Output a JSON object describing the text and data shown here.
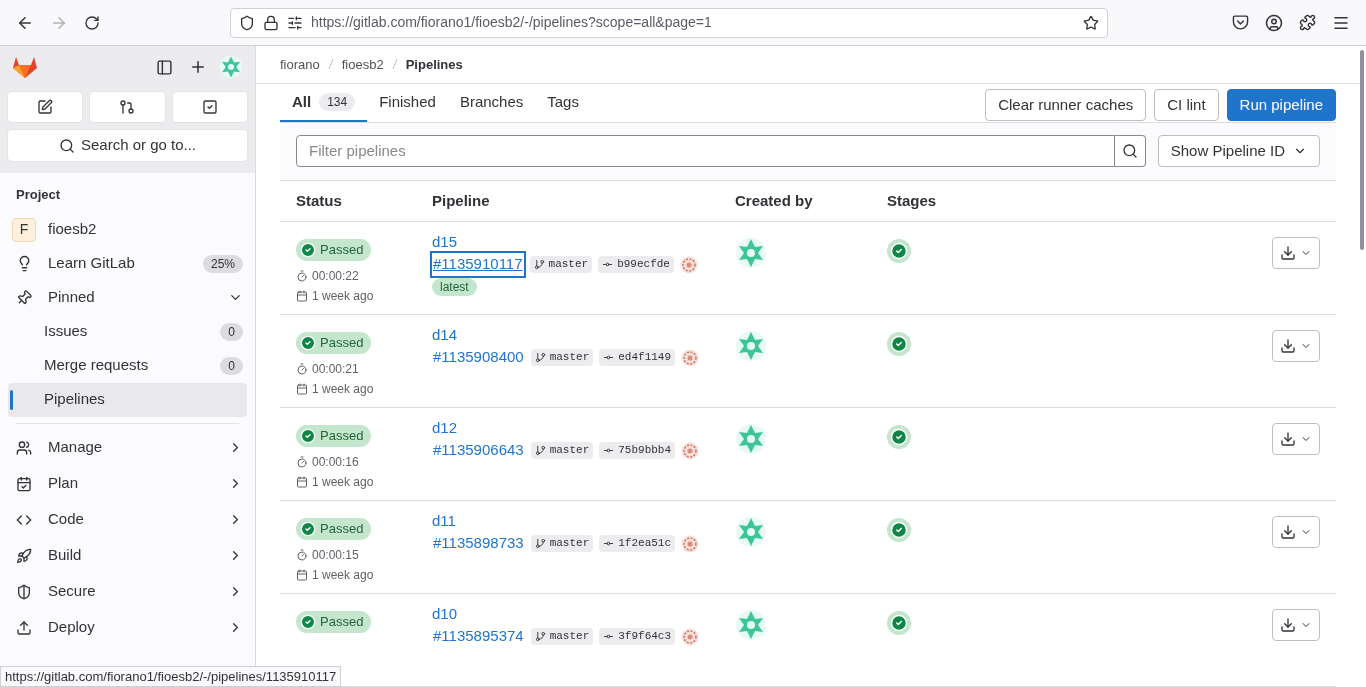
{
  "browser": {
    "url": "https://gitlab.com/fiorano1/fioesb2/-/pipelines?scope=all&page=1"
  },
  "sidebar": {
    "search": "Search or go to...",
    "section": "Project",
    "project": {
      "initial": "F",
      "name": "fioesb2"
    },
    "learn": {
      "label": "Learn GitLab",
      "badge": "25%"
    },
    "pinned": {
      "label": "Pinned",
      "expanded": true,
      "items": [
        {
          "label": "Issues",
          "count": "0",
          "selected": false
        },
        {
          "label": "Merge requests",
          "count": "0",
          "selected": false
        },
        {
          "label": "Pipelines",
          "selected": true
        }
      ]
    },
    "groups": [
      {
        "kind": "manage",
        "label": "Manage"
      },
      {
        "kind": "plan",
        "label": "Plan"
      },
      {
        "kind": "code",
        "label": "Code"
      },
      {
        "kind": "build",
        "label": "Build"
      },
      {
        "kind": "secure",
        "label": "Secure"
      },
      {
        "kind": "deploy",
        "label": "Deploy"
      }
    ]
  },
  "breadcrumb": [
    "fiorano",
    "fioesb2",
    "Pipelines"
  ],
  "tabs": [
    {
      "label": "All",
      "count": "134",
      "selected": true
    },
    {
      "label": "Finished",
      "selected": false
    },
    {
      "label": "Branches",
      "selected": false
    },
    {
      "label": "Tags",
      "selected": false
    }
  ],
  "actions": [
    {
      "label": "Clear runner caches",
      "primary": false
    },
    {
      "label": "CI lint",
      "primary": false
    },
    {
      "label": "Run pipeline",
      "primary": true
    }
  ],
  "filter": {
    "placeholder": "Filter pipelines",
    "dropdown": "Show Pipeline ID"
  },
  "table": {
    "columns": [
      "Status",
      "Pipeline",
      "Created by",
      "Stages"
    ],
    "rows": [
      {
        "status": "Passed",
        "duration": "00:00:22",
        "when": "1 week ago",
        "name": "d15",
        "id": "#1135910117",
        "focused": true,
        "branch": "master",
        "commit": "b99ecfde",
        "latest": "latest"
      },
      {
        "status": "Passed",
        "duration": "00:00:21",
        "when": "1 week ago",
        "name": "d14",
        "id": "#1135908400",
        "focused": false,
        "branch": "master",
        "commit": "ed4f1149"
      },
      {
        "status": "Passed",
        "duration": "00:00:16",
        "when": "1 week ago",
        "name": "d12",
        "id": "#1135906643",
        "focused": false,
        "branch": "master",
        "commit": "75b9bbb4"
      },
      {
        "status": "Passed",
        "duration": "00:00:15",
        "when": "1 week ago",
        "name": "d11",
        "id": "#1135898733",
        "focused": false,
        "branch": "master",
        "commit": "1f2ea51c"
      },
      {
        "status": "Passed",
        "name": "d10",
        "id": "#1135895374",
        "focused": false,
        "branch": "master",
        "commit": "3f9f64c3"
      }
    ]
  },
  "status_link": "https://gitlab.com/fiorano1/fioesb2/-/pipelines/1135910117"
}
